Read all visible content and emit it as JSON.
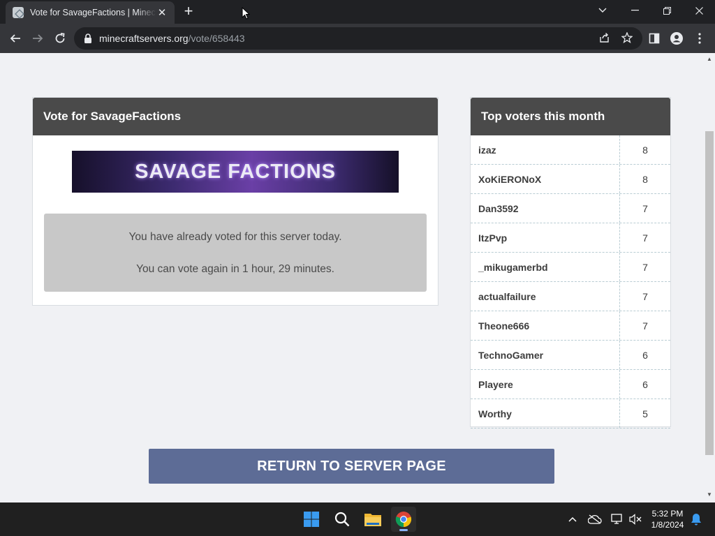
{
  "browser": {
    "tab_title": "Vote for SavageFactions | Minecraft",
    "url_host": "minecraftservers.org",
    "url_path": "/vote/658443"
  },
  "vote_card": {
    "heading": "Vote for SavageFactions",
    "banner_text": "SAVAGE FACTIONS",
    "notice_line1": "You have already voted for this server today.",
    "notice_line2": "You can vote again in 1 hour, 29 minutes."
  },
  "top_voters": {
    "heading": "Top voters this month",
    "rows": [
      {
        "name": "izaz",
        "votes": "8"
      },
      {
        "name": "XoKiERONoX",
        "votes": "8"
      },
      {
        "name": "Dan3592",
        "votes": "7"
      },
      {
        "name": "ItzPvp",
        "votes": "7"
      },
      {
        "name": "_mikugamerbd",
        "votes": "7"
      },
      {
        "name": "actualfailure",
        "votes": "7"
      },
      {
        "name": "Theone666",
        "votes": "7"
      },
      {
        "name": "TechnoGamer",
        "votes": "6"
      },
      {
        "name": "Playere",
        "votes": "6"
      },
      {
        "name": "Worthy",
        "votes": "5"
      }
    ]
  },
  "return_button": "RETURN TO SERVER PAGE",
  "taskbar": {
    "time": "5:32 PM",
    "date": "1/8/2024"
  },
  "colors": {
    "card_header": "#4a4a4a",
    "return_button": "#5d6c96",
    "notice_bg": "#c8c8c8"
  }
}
